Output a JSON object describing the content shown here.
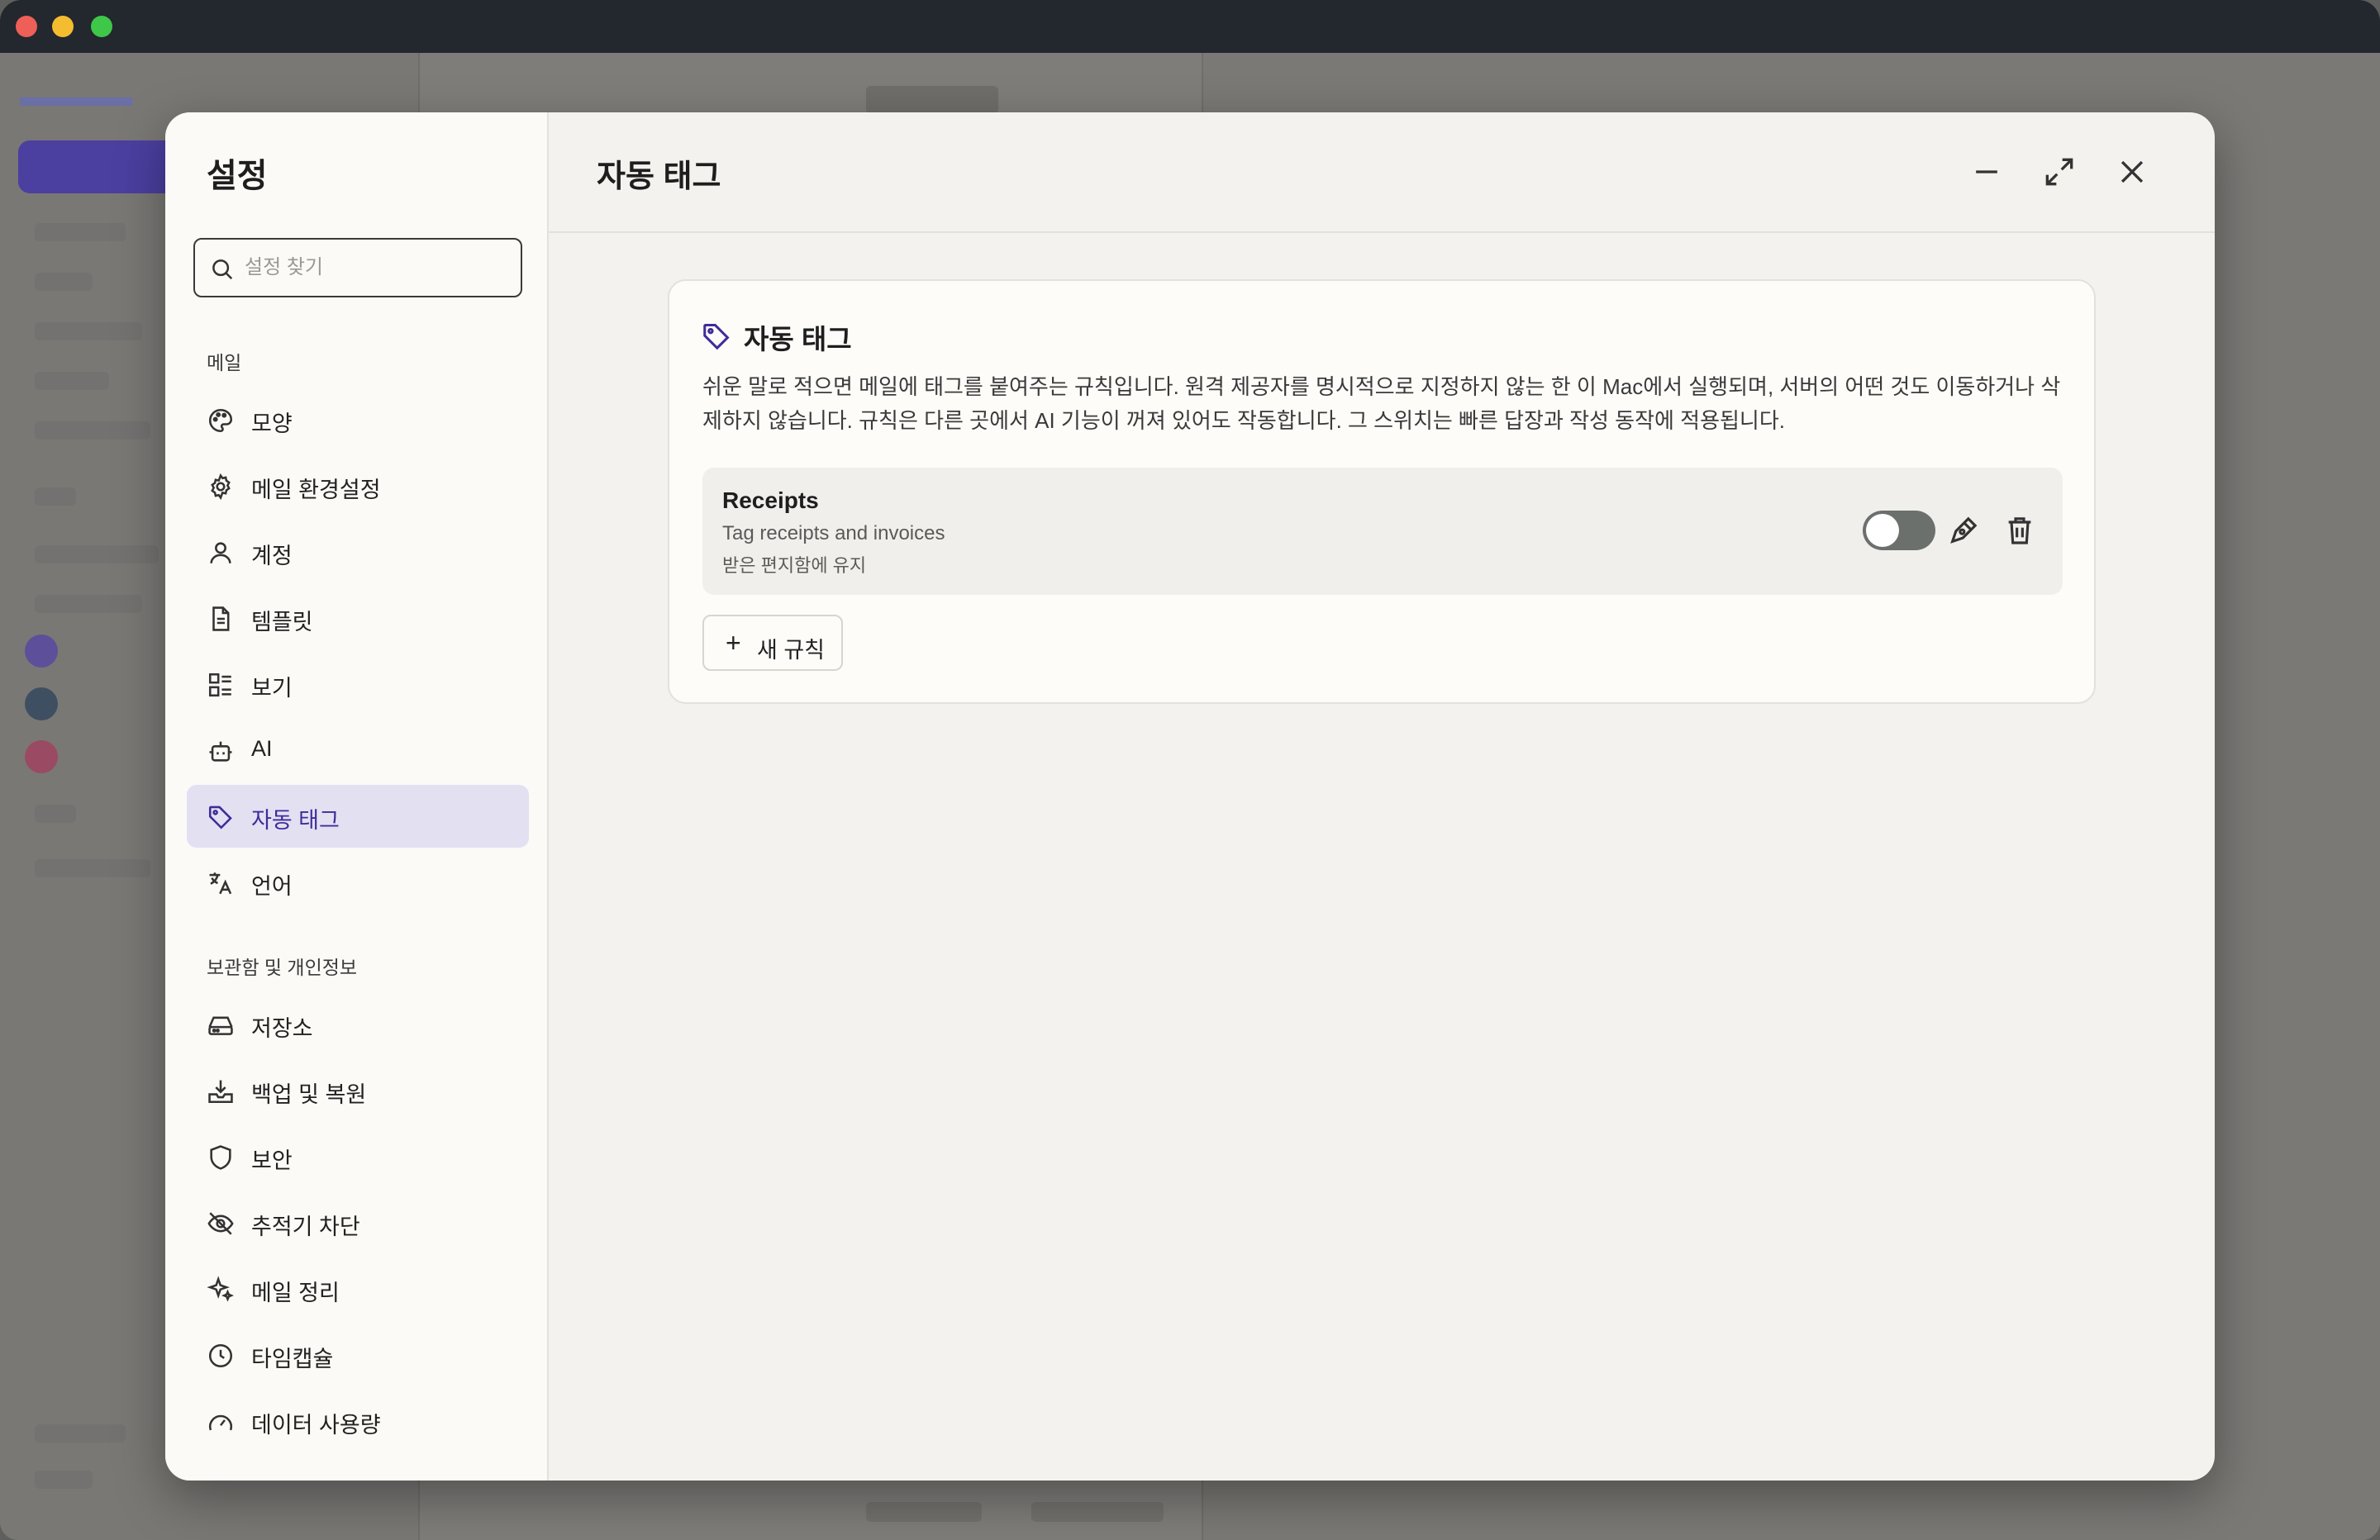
{
  "settings": {
    "title": "설정",
    "search_placeholder": "설정 찾기",
    "sections": [
      {
        "label": "메일",
        "items": [
          {
            "label": "모양",
            "icon": "palette-icon"
          },
          {
            "label": "메일 환경설정",
            "icon": "gear-icon"
          },
          {
            "label": "계정",
            "icon": "user-icon"
          },
          {
            "label": "템플릿",
            "icon": "document-icon"
          },
          {
            "label": "보기",
            "icon": "layout-list-icon"
          },
          {
            "label": "AI",
            "icon": "robot-icon"
          },
          {
            "label": "자동 태그",
            "icon": "tag-icon",
            "active": true
          },
          {
            "label": "언어",
            "icon": "translate-icon"
          }
        ]
      },
      {
        "label": "보관함 및 개인정보",
        "items": [
          {
            "label": "저장소",
            "icon": "hard-drive-icon"
          },
          {
            "label": "백업 및 복원",
            "icon": "download-tray-icon"
          },
          {
            "label": "보안",
            "icon": "shield-icon"
          },
          {
            "label": "추적기 차단",
            "icon": "eye-off-icon"
          },
          {
            "label": "메일 정리",
            "icon": "sparkles-icon"
          },
          {
            "label": "타임캡슐",
            "icon": "clock-icon"
          },
          {
            "label": "데이터 사용량",
            "icon": "gauge-icon"
          }
        ]
      }
    ]
  },
  "main": {
    "title": "자동 태그",
    "card": {
      "title": "자동 태그",
      "description": "쉬운 말로 적으면 메일에 태그를 붙여주는 규칙입니다. 원격 제공자를 명시적으로 지정하지 않는 한 이 Mac에서 실행되며, 서버의 어떤 것도 이동하거나 삭제하지 않습니다. 규칙은 다른 곳에서 AI 기능이 꺼져 있어도 작동합니다. 그 스위치는 빠른 답장과 작성 동작에 적용됩니다.",
      "rules": [
        {
          "name": "Receipts",
          "description": "Tag receipts and invoices",
          "folder": "받은 편지함에 유지",
          "enabled": false
        }
      ],
      "add_rule_label": "새 규칙"
    }
  },
  "colors": {
    "accent": "#3f2c9a",
    "active_nav_bg": "#e3e0f2",
    "toggle_off": "#6c706d"
  }
}
